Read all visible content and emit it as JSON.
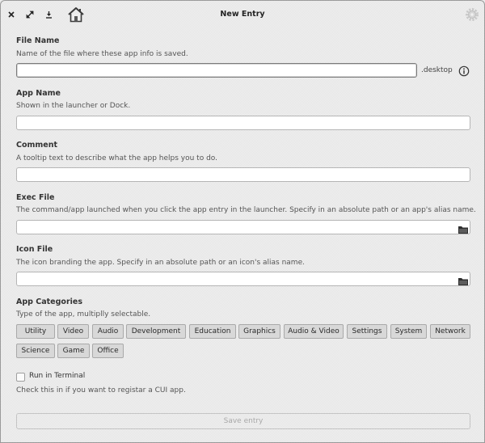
{
  "window": {
    "title": "New Entry",
    "icons": [
      "close-icon",
      "maximize-icon",
      "download-icon",
      "home-icon",
      "gear-icon"
    ]
  },
  "file_name": {
    "title": "File Name",
    "description": "Name of the file where these app info is saved.",
    "value": "",
    "suffix": ".desktop"
  },
  "app_name": {
    "title": "App Name",
    "description": "Shown in the launcher or Dock.",
    "value": ""
  },
  "comment": {
    "title": "Comment",
    "description": "A tooltip text to describe what the app helps you to do.",
    "value": ""
  },
  "exec_file": {
    "title": "Exec File",
    "description": "The command/app launched when you click the app entry in the launcher. Specify in an absolute path or an app's alias name.",
    "value": ""
  },
  "icon_file": {
    "title": "Icon File",
    "description": "The icon branding the app. Specify in an absolute path or an icon's alias name.",
    "value": ""
  },
  "categories": {
    "title": "App Categories",
    "description": "Type of the app, multiplly selectable.",
    "items": [
      "Utility",
      "Video",
      "Audio",
      "Development",
      "Education",
      "Graphics",
      "Audio & Video",
      "Settings",
      "System",
      "Network",
      "Science",
      "Game",
      "Office"
    ]
  },
  "terminal": {
    "label": "Run in Terminal",
    "checked": false,
    "description": "Check this in if you want to registar a CUI app."
  },
  "save_label": "Save entry"
}
